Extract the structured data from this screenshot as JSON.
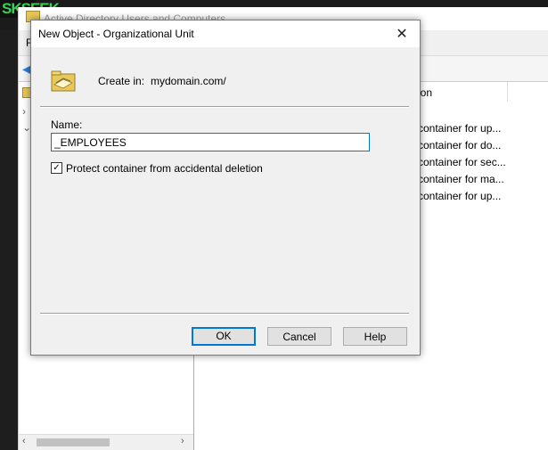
{
  "background": {
    "logo_text": "SKSEEK",
    "window_title": "Active Directory Users and Computers",
    "menu_first": "F",
    "column_header": "ion",
    "descriptions": [
      "container for up...",
      "container for do...",
      "container for sec...",
      "container for ma...",
      "container for up..."
    ]
  },
  "dialog": {
    "title": "New Object - Organizational Unit",
    "create_in_label": "Create in:",
    "create_in_value": "mydomain.com/",
    "name_label": "Name:",
    "name_value": "_EMPLOYEES",
    "protect_label": "Protect container from accidental deletion",
    "protect_checked": true,
    "ok_label": "OK",
    "cancel_label": "Cancel",
    "help_label": "Help"
  },
  "icons": {
    "close": "close-icon",
    "ou": "organizational-unit-icon",
    "back": "back-arrow-icon"
  },
  "colors": {
    "accent": "#0078d7",
    "folder": "#e8c85a",
    "logo_green": "#39d353"
  }
}
